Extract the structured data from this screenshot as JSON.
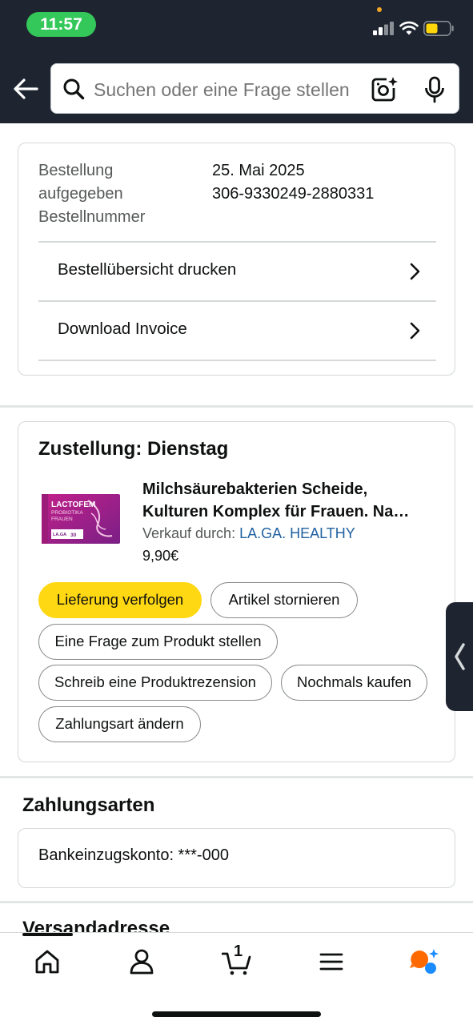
{
  "status_bar": {
    "time": "11:57"
  },
  "search": {
    "placeholder": "Suchen oder eine Frage stellen"
  },
  "order": {
    "labels": [
      "Bestellung",
      "aufgegeben",
      "Bestellnummer"
    ],
    "date": "25. Mai 2025",
    "number": "306-9330249-2880331",
    "links": [
      {
        "label": "Bestellübersicht drucken"
      },
      {
        "label": "Download Invoice"
      }
    ]
  },
  "delivery": {
    "title": "Zustellung: Dienstag",
    "product": {
      "title_line1": "Milchsäurebakterien Scheide,",
      "title_line2": "Kulturen Komplex für Frauen. Na…",
      "seller_prefix": "Verkauf durch:",
      "seller_name": "LA.GA. HEALTHY",
      "price": "9,90€",
      "image_brand": "LACTOFEM",
      "image_sub1": "PROBIOTIKA",
      "image_sub2": "FRAUEN",
      "image_maker": "LA.GA",
      "image_count": "30"
    },
    "actions": {
      "track": "Lieferung verfolgen",
      "cancel": "Artikel stornieren",
      "question": "Eine Frage zum Produkt stellen",
      "review": "Schreib eine Produktrezension",
      "rebuy": "Nochmals kaufen",
      "payment": "Zahlungsart ändern"
    }
  },
  "payment": {
    "title": "Zahlungsarten",
    "account": "Bankeinzugskonto: ***-000"
  },
  "shipping": {
    "title": "Versandadresse"
  },
  "bottom_nav": {
    "cart_count": "1"
  },
  "colors": {
    "header_bg": "#1e2530",
    "accent_yellow": "#ffd814",
    "link_blue": "#2162a1",
    "status_green": "#34c759"
  }
}
